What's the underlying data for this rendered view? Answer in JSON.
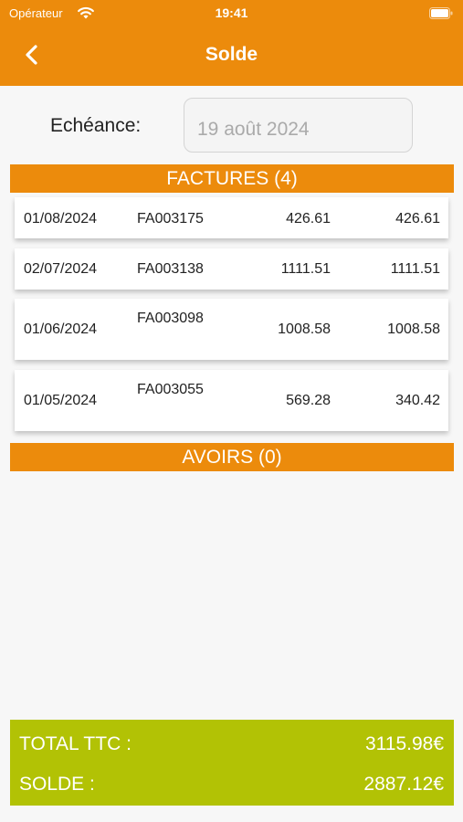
{
  "status_bar": {
    "carrier": "Opérateur",
    "time": "19:41"
  },
  "nav": {
    "title": "Solde"
  },
  "filter": {
    "label": "Echéance:",
    "date_value": "19 août 2024"
  },
  "factures": {
    "header": "FACTURES (4)",
    "rows": [
      {
        "date": "01/08/2024",
        "number": "FA003175",
        "amount": "426.61",
        "balance": "426.61"
      },
      {
        "date": "02/07/2024",
        "number": "FA003138",
        "amount": "1111.51",
        "balance": "1111.51"
      },
      {
        "date": "01/06/2024",
        "number": "FA003098",
        "amount": "1008.58",
        "balance": "1008.58"
      },
      {
        "date": "01/05/2024",
        "number": "FA003055",
        "amount": "569.28",
        "balance": "340.42"
      }
    ]
  },
  "avoirs": {
    "header": "AVOIRS (0)"
  },
  "totals": {
    "total_label": "TOTAL TTC :",
    "total_value": "3115.98€",
    "solde_label": "SOLDE :",
    "solde_value": "2887.12€"
  },
  "colors": {
    "primary": "#ec8b0c",
    "totals_bg": "#b2c205",
    "background": "#f7f7f7"
  }
}
